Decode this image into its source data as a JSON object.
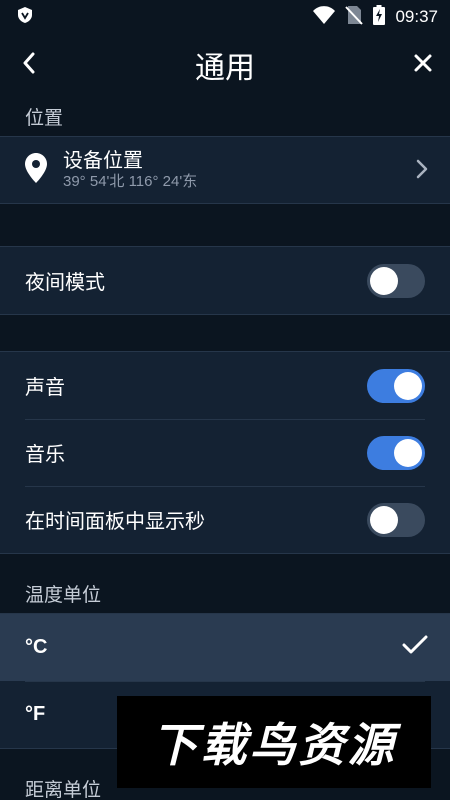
{
  "status_bar": {
    "time": "09:37",
    "icons": [
      "shield-app-icon",
      "wifi-icon",
      "no-sim-icon",
      "battery-charging-icon"
    ]
  },
  "header": {
    "title": "通用",
    "back_icon": "chevron-left-icon",
    "close_icon": "close-icon"
  },
  "location_section": {
    "header": "位置",
    "item": {
      "title": "设备位置",
      "subtitle": "39° 54'北 116° 24'东",
      "icon": "location-pin-icon"
    }
  },
  "night_mode": {
    "label": "夜间模式",
    "enabled": false
  },
  "sound_section": {
    "items": [
      {
        "label": "声音",
        "enabled": true
      },
      {
        "label": "音乐",
        "enabled": true
      },
      {
        "label": "在时间面板中显示秒",
        "enabled": false
      }
    ]
  },
  "temperature_section": {
    "header": "温度单位",
    "options": [
      {
        "label": "°C",
        "selected": true
      },
      {
        "label": "°F",
        "selected": false
      }
    ]
  },
  "distance_section": {
    "header": "距离单位"
  },
  "watermark": {
    "text": "下载鸟资源"
  },
  "colors": {
    "background": "#0b1520",
    "card": "#142233",
    "selected_row": "#2a3b51",
    "toggle_on": "#3d7de0",
    "toggle_off": "#3a4a5e"
  }
}
